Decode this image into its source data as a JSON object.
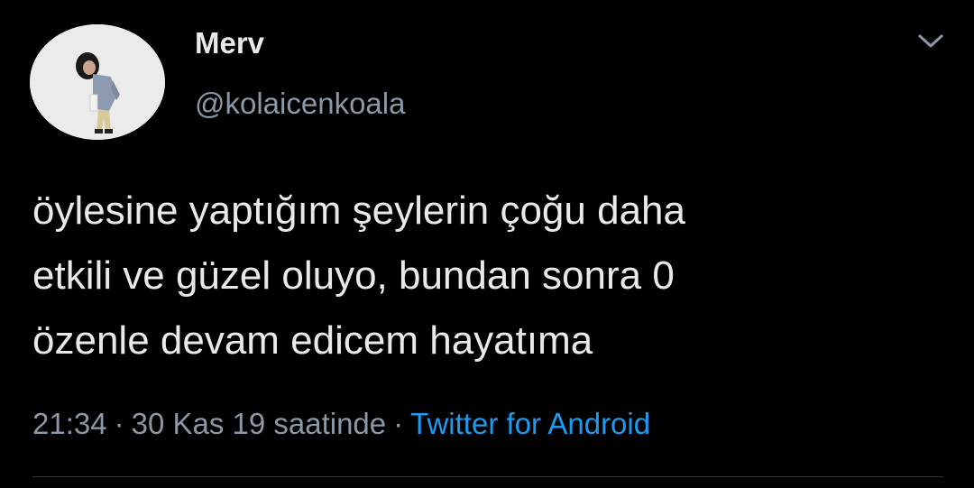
{
  "tweet": {
    "display_name": "Merv",
    "username": "@kolaicenkoala",
    "text": "öylesine yaptığım şeylerin çoğu daha\netkili ve güzel oluyo, bundan sonra 0\nözenle devam edicem hayatıma",
    "time": "21:34",
    "date": "30 Kas 19 saatinde",
    "source": "Twitter for Android",
    "separator": "·"
  },
  "icons": {
    "caret": "chevron-down-icon",
    "avatar": "profile-photo"
  },
  "colors": {
    "background": "#000000",
    "primary_text": "#e7e9ea",
    "secondary_text": "#8b98a5",
    "link": "#1d9bf0",
    "divider": "#2f3336"
  }
}
